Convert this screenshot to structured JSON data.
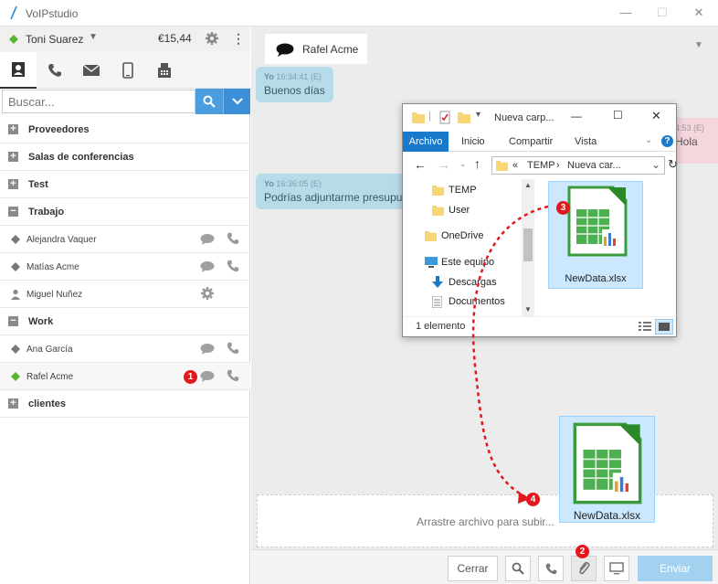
{
  "window": {
    "title": "VoIPstudio",
    "minimize": "—",
    "maximize": "☐",
    "close": "✕"
  },
  "user": {
    "name": "Toni Suarez",
    "balance": "€15,44"
  },
  "search": {
    "placeholder": "Buscar..."
  },
  "contacts": [
    {
      "type": "group",
      "label": "Proveedores",
      "expanded": false
    },
    {
      "type": "group",
      "label": "Salas de conferencias",
      "expanded": false
    },
    {
      "type": "group",
      "label": "Test",
      "expanded": false
    },
    {
      "type": "group",
      "label": "Trabajo",
      "expanded": true
    },
    {
      "type": "contact",
      "label": "Alejandra Vaquer",
      "status": "offline"
    },
    {
      "type": "contact",
      "label": "Matías Acme",
      "status": "offline"
    },
    {
      "type": "contact",
      "label": "Miguel Nuñez",
      "status": "user"
    },
    {
      "type": "group",
      "label": "Work",
      "expanded": true
    },
    {
      "type": "contact",
      "label": "Ana García",
      "status": "offline"
    },
    {
      "type": "contact",
      "label": "Rafel Acme",
      "status": "online"
    },
    {
      "type": "group",
      "label": "clientes",
      "expanded": false
    }
  ],
  "chat": {
    "tab_name": "Rafel Acme",
    "messages": [
      {
        "author": "Yo",
        "time": "16:34:41 (E)",
        "text": "Buenos días"
      },
      {
        "author": "Yo",
        "time": "16:36:05 (E)",
        "text": "Podrías adjuntarme presupu"
      }
    ],
    "incoming": {
      "time": "4:53 (E)",
      "text": "Hola"
    },
    "dropzone_text": "Arrastre archivo para subir...",
    "buttons": {
      "close": "Cerrar",
      "send": "Enviar"
    }
  },
  "explorer": {
    "title": "Nueva carp...",
    "ribbon_tabs": [
      "Archivo",
      "Inicio",
      "Compartir",
      "Vista"
    ],
    "address": [
      "«",
      "TEMP",
      "›",
      "Nueva car..."
    ],
    "tree": [
      "TEMP",
      "User",
      "OneDrive",
      "Este equipo",
      "Descargas",
      "Documentos"
    ],
    "file_name": "NewData.xlsx",
    "status": "1 elemento"
  },
  "dragged_file": {
    "name": "NewData.xlsx"
  },
  "markers": [
    "1",
    "2",
    "3",
    "4"
  ],
  "colors": {
    "accent": "#4a9ee0",
    "marker": "#e3171c",
    "bubble": "#b7dce9",
    "online": "#5cb531"
  }
}
